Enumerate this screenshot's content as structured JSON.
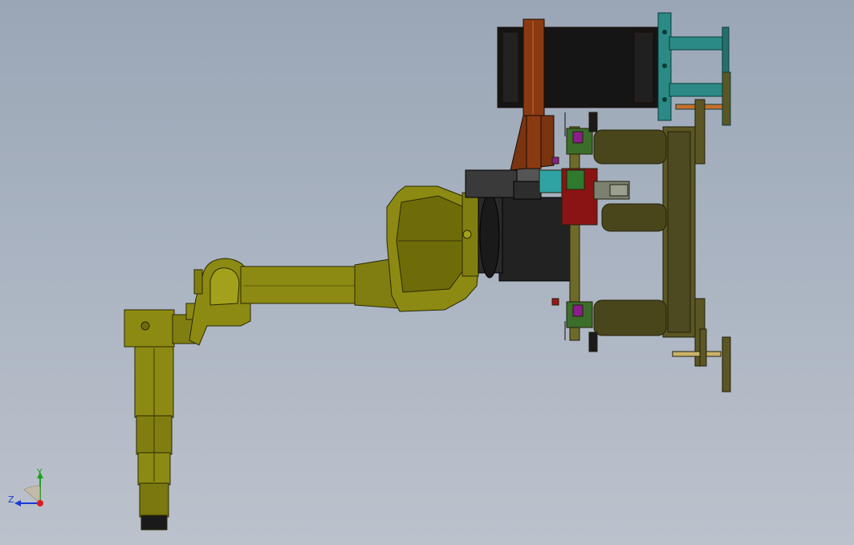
{
  "viewport": {
    "background_top": "#9aa6b6",
    "background_bottom": "#bcc2cc"
  },
  "model": {
    "robot_color": "#8c8a12",
    "robot_shadow": "#5e5c05",
    "motor_color": "#1e1e1e",
    "bracket_color": "#8a3a12",
    "frame_color": "#2b8a86",
    "fixture_color": "#5b5624"
  },
  "triad": {
    "y_label": "Y",
    "z_label": "Z",
    "x_color": "#d81e1e",
    "y_color": "#1aa31a",
    "z_color": "#1a3ad8"
  }
}
